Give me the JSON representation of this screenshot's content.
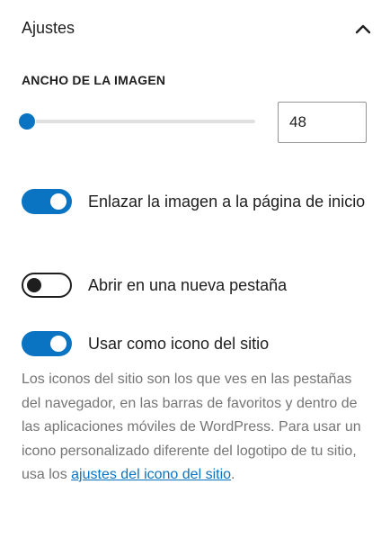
{
  "panel": {
    "title": "Ajustes",
    "collapse_icon": "chevron-up-icon"
  },
  "image_width": {
    "label": "ANCHO DE LA IMAGEN",
    "value": "48",
    "slider_fraction": 0.0
  },
  "toggles": [
    {
      "label": "Enlazar la imagen a la página de inicio",
      "checked": true
    },
    {
      "label": "Abrir en una nueva pestaña",
      "checked": false
    },
    {
      "label": "Usar como icono del sitio",
      "checked": true
    }
  ],
  "help": {
    "text_before_link": "Los iconos del sitio son los que ves en las pestañas del navegador, en las barras de favoritos y dentro de las aplicaciones móviles de WordPress. Para usar un icono personalizado diferente del logotipo de tu sitio, usa los ",
    "link_text": "ajustes del icono del sitio",
    "text_after_link": "."
  },
  "colors": {
    "accent": "#0a74c2",
    "text": "#1e1e1e",
    "muted_text": "#757575",
    "track": "#e0e0e0"
  }
}
